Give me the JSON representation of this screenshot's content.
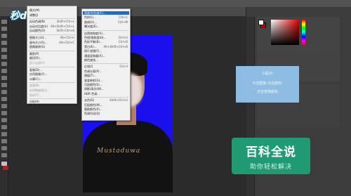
{
  "watermark": {
    "logo_text": "秒dong视频"
  },
  "left_menu": {
    "items": [
      {
        "label": "模式(M)",
        "shortcut": "",
        "state": "normal"
      },
      {
        "label": "调整(J)",
        "shortcut": "",
        "state": "normal"
      },
      {
        "label": "自动色调(N)",
        "shortcut": "Shift+Ctrl+L",
        "state": "normal"
      },
      {
        "label": "自动对比度(U)",
        "shortcut": "Alt+Shift+Ctrl+L",
        "state": "normal"
      },
      {
        "label": "自动颜色(O)",
        "shortcut": "Shift+Ctrl+B",
        "state": "normal"
      },
      {
        "label": "图像大小(I)...",
        "shortcut": "Alt+Ctrl+I",
        "state": "normal"
      },
      {
        "label": "画布大小(S)...",
        "shortcut": "Alt+Ctrl+C",
        "state": "normal"
      },
      {
        "label": "图像旋转(G)",
        "shortcut": "",
        "state": "normal"
      },
      {
        "label": "裁剪(P)",
        "shortcut": "",
        "state": "normal"
      },
      {
        "label": "裁切(R)...",
        "shortcut": "",
        "state": "normal"
      },
      {
        "label": "显示全部(V)",
        "shortcut": "",
        "state": "dim"
      },
      {
        "label": "复制(D)...",
        "shortcut": "",
        "state": "normal"
      },
      {
        "label": "应用图像(Y)...",
        "shortcut": "",
        "state": "normal"
      },
      {
        "label": "计算(C)...",
        "shortcut": "",
        "state": "normal"
      },
      {
        "label": "变量(B)",
        "shortcut": "",
        "state": "dim"
      },
      {
        "label": "应用数据组(L)...",
        "shortcut": "",
        "state": "dim"
      },
      {
        "label": "陷印(T)...",
        "shortcut": "",
        "state": "dim"
      },
      {
        "label": "分析(A)",
        "shortcut": "",
        "state": "normal"
      }
    ]
  },
  "right_menu": {
    "items": [
      {
        "label": "亮度/对比度(C)...",
        "shortcut": "",
        "state": "selected"
      },
      {
        "label": "色阶(L)...",
        "shortcut": "Ctrl+L",
        "state": "normal"
      },
      {
        "label": "曲线(U)...",
        "shortcut": "Ctrl+M",
        "state": "normal"
      },
      {
        "label": "曝光度(E)...",
        "shortcut": "",
        "state": "normal"
      },
      {
        "label": "自然饱和度(V)...",
        "shortcut": "",
        "state": "normal"
      },
      {
        "label": "色相/饱和度(H)...",
        "shortcut": "Ctrl+U",
        "state": "normal"
      },
      {
        "label": "色彩平衡(B)...",
        "shortcut": "Ctrl+B",
        "state": "normal"
      },
      {
        "label": "黑白(K)...",
        "shortcut": "Alt+Shift+Ctrl+B",
        "state": "normal"
      },
      {
        "label": "照片滤镜(F)...",
        "shortcut": "",
        "state": "normal"
      },
      {
        "label": "通道混和器(X)...",
        "shortcut": "",
        "state": "normal"
      },
      {
        "label": "颜色查找...",
        "shortcut": "",
        "state": "normal"
      },
      {
        "label": "反相(I)",
        "shortcut": "Ctrl+I",
        "state": "normal"
      },
      {
        "label": "色调分离(P)...",
        "shortcut": "",
        "state": "normal"
      },
      {
        "label": "阈值(T)...",
        "shortcut": "",
        "state": "normal"
      },
      {
        "label": "渐变映射(G)...",
        "shortcut": "",
        "state": "normal"
      },
      {
        "label": "可选颜色(S)...",
        "shortcut": "",
        "state": "normal"
      },
      {
        "label": "阴影/高光(W)...",
        "shortcut": "",
        "state": "normal"
      },
      {
        "label": "HDR 色调...",
        "shortcut": "",
        "state": "normal"
      },
      {
        "label": "去色(D)",
        "shortcut": "Shift+Ctrl+U",
        "state": "normal"
      },
      {
        "label": "匹配颜色(M)...",
        "shortcut": "",
        "state": "normal"
      },
      {
        "label": "替换颜色(R)...",
        "shortcut": "",
        "state": "normal"
      },
      {
        "label": "色调均化(Q)",
        "shortcut": "",
        "state": "normal"
      }
    ]
  },
  "photo": {
    "background_color": "#1a10ee",
    "shirt_text": "Mustaduwa"
  },
  "tip": {
    "title": "小提示:",
    "line1": "点击图像-点击颜色-",
    "line2": "点击替换颜色"
  },
  "badge": {
    "title": "百科全说",
    "subtitle": "助你轻松解决"
  },
  "colors": {
    "accent_blue": "#2d6ab5",
    "tip_bg": "#93c4ec",
    "badge_green": "#1f9a72"
  }
}
